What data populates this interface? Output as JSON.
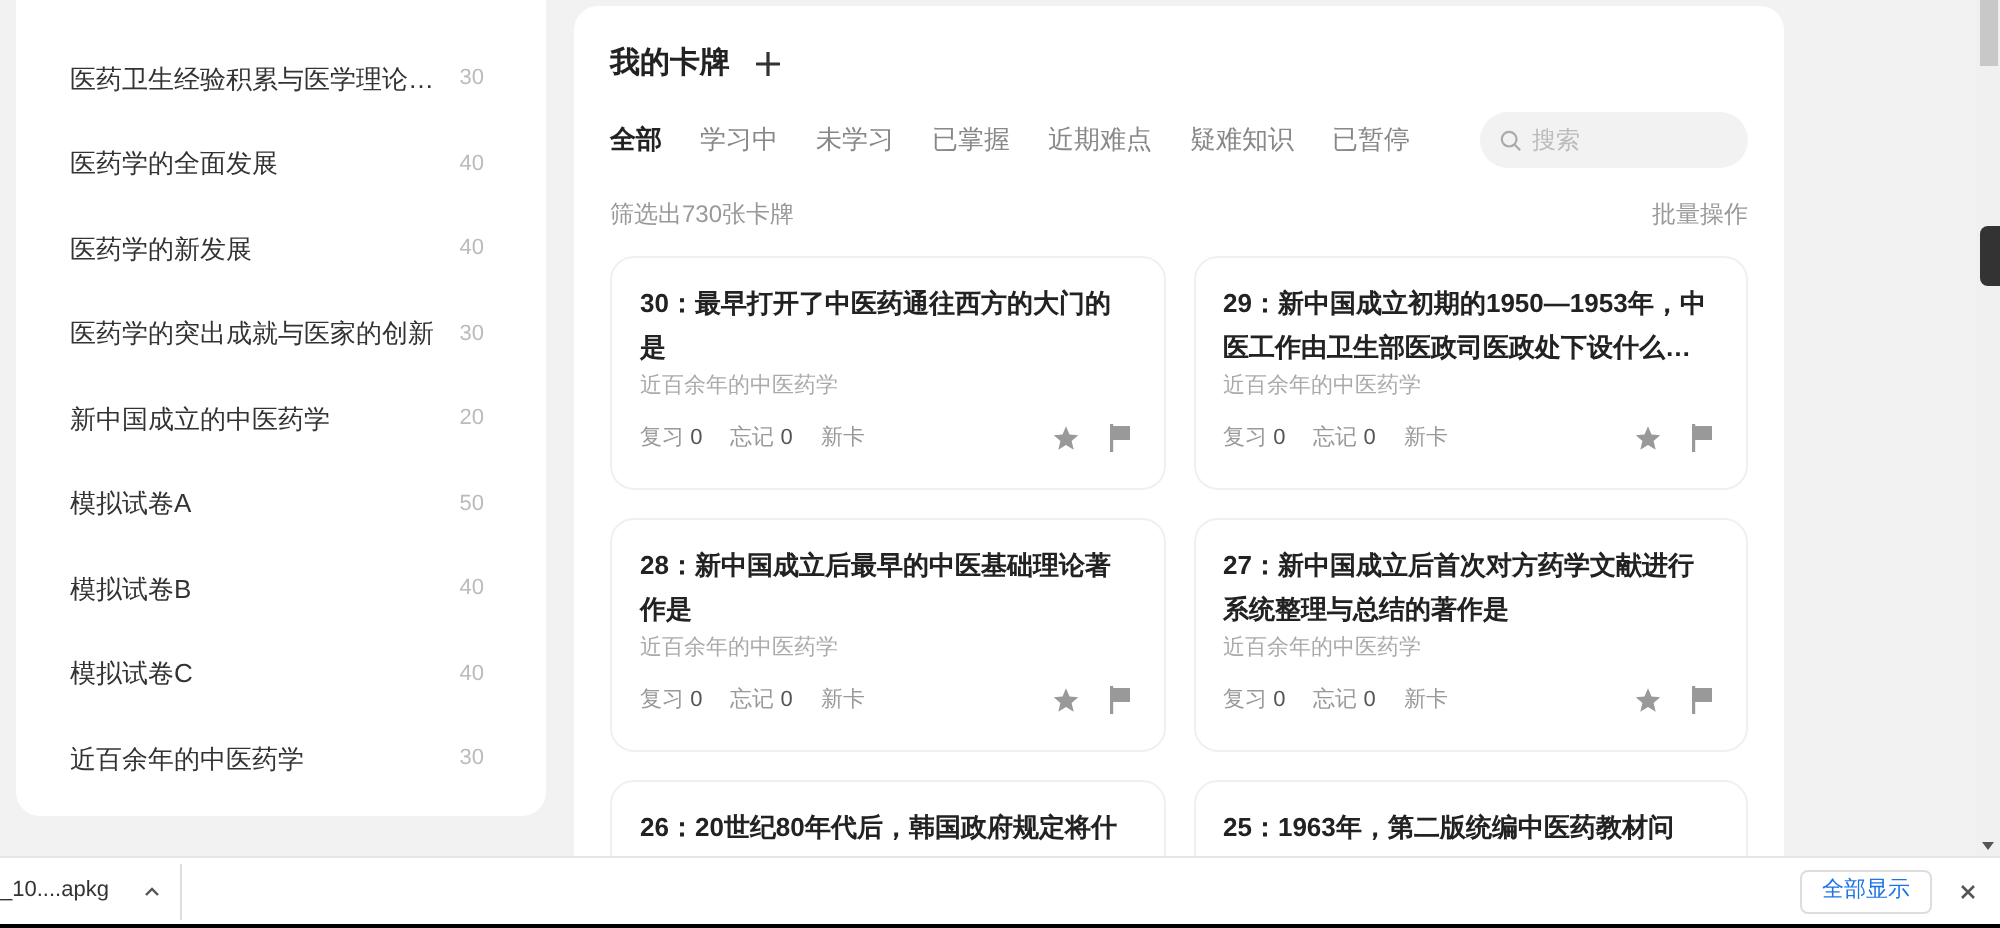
{
  "sidebar": {
    "items": [
      {
        "title": "医药卫生经验积累与医学理论…",
        "count": "30"
      },
      {
        "title": "医药学的全面发展",
        "count": "40"
      },
      {
        "title": "医药学的新发展",
        "count": "40"
      },
      {
        "title": "医药学的突出成就与医家的创新",
        "count": "30"
      },
      {
        "title": "新中国成立的中医药学",
        "count": "20"
      },
      {
        "title": "模拟试卷A",
        "count": "50"
      },
      {
        "title": "模拟试卷B",
        "count": "40"
      },
      {
        "title": "模拟试卷C",
        "count": "40"
      },
      {
        "title": "近百余年的中医药学",
        "count": "30"
      }
    ]
  },
  "main": {
    "title": "我的卡牌",
    "tabs": [
      {
        "label": "全部",
        "selected": true
      },
      {
        "label": "学习中",
        "selected": false
      },
      {
        "label": "未学习",
        "selected": false
      },
      {
        "label": "已掌握",
        "selected": false
      },
      {
        "label": "近期难点",
        "selected": false
      },
      {
        "label": "疑难知识",
        "selected": false
      },
      {
        "label": "已暂停",
        "selected": false
      }
    ],
    "search": {
      "placeholder": "搜索"
    },
    "filter_count": "筛选出730张卡牌",
    "batch_action": "批量操作",
    "cards": [
      {
        "title": "30：最早打开了中医药通往西方的大门的是",
        "deck": "近百余年的中医药学",
        "review": "复习",
        "review_count": "0",
        "forget": "忘记",
        "forget_count": "0",
        "status": "新卡",
        "starred": false,
        "flagged": false
      },
      {
        "title": "29：新中国成立初期的1950—1953年，中医工作由卫生部医政司医政处下设什么…",
        "deck": "近百余年的中医药学",
        "review": "复习",
        "review_count": "0",
        "forget": "忘记",
        "forget_count": "0",
        "status": "新卡",
        "starred": false,
        "flagged": false
      },
      {
        "title": "28：新中国成立后最早的中医基础理论著作是",
        "deck": "近百余年的中医药学",
        "review": "复习",
        "review_count": "0",
        "forget": "忘记",
        "forget_count": "0",
        "status": "新卡",
        "starred": false,
        "flagged": false
      },
      {
        "title": "27：新中国成立后首次对方药学文献进行系统整理与总结的著作是",
        "deck": "近百余年的中医药学",
        "review": "复习",
        "review_count": "0",
        "forget": "忘记",
        "forget_count": "0",
        "status": "新卡",
        "starred": false,
        "flagged": false
      },
      {
        "title": "26：20世纪80年代后，韩国政府规定将什"
      },
      {
        "title": "25：1963年，第二版统编中医药教材问"
      }
    ]
  },
  "download_bar": {
    "file": "_10....apkg",
    "show_all": "全部显示"
  }
}
